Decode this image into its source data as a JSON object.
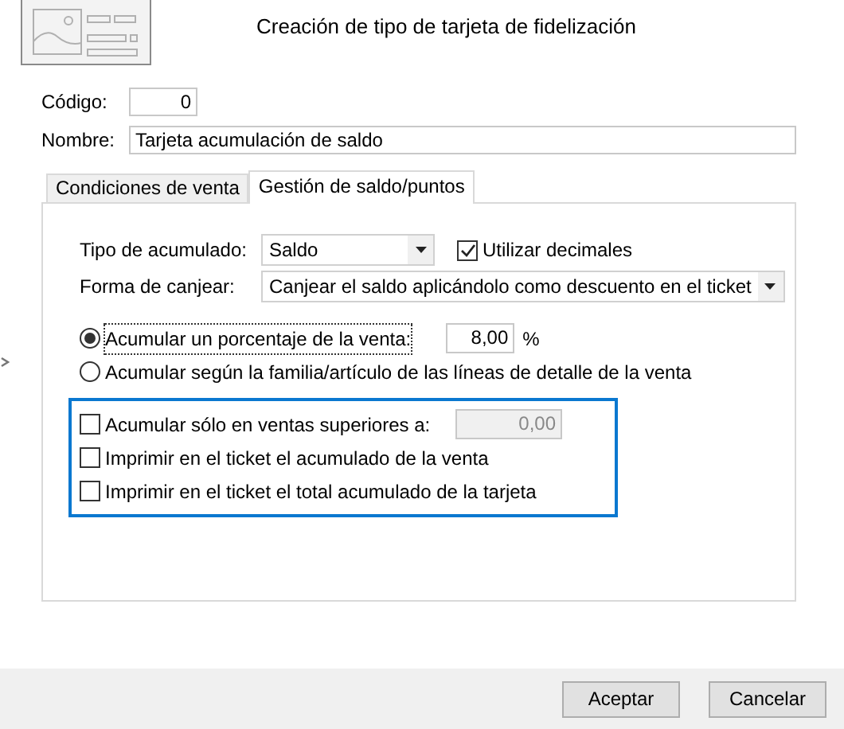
{
  "window": {
    "title": "Creación de tipo de tarjeta de fidelización"
  },
  "fields": [
    {
      "label": "Código:",
      "value": "0",
      "kind": "short"
    },
    {
      "label": "Nombre:",
      "value": "Tarjeta acumulación de saldo",
      "kind": "wide"
    }
  ],
  "tabs": [
    {
      "label": "Condiciones de venta",
      "selected": false
    },
    {
      "label": "Gestión de saldo/puntos",
      "selected": true
    }
  ],
  "selects": [
    {
      "label": "Tipo de acumulado:",
      "value": "Saldo",
      "kind": "short"
    },
    {
      "label": "Forma de canjear:",
      "value": "Canjear el saldo aplicándolo como descuento en el ticket",
      "kind": "wide"
    }
  ],
  "decimals_checkbox": {
    "label": "Utilizar decimales",
    "checked": true
  },
  "radios": [
    {
      "label": "Acumular un porcentaje de la venta:",
      "selected": true,
      "focused": true,
      "value": "8,00",
      "unit": "%"
    },
    {
      "label": "Acumular según la familia/artículo de las líneas de detalle de la venta",
      "selected": false,
      "focused": false
    }
  ],
  "options_group": {
    "focused": true,
    "items": [
      {
        "label": "Acumular sólo en ventas superiores a:",
        "checked": false,
        "value": "0,00",
        "disabled": true
      },
      {
        "label": "Imprimir en el ticket el acumulado de la venta",
        "checked": false
      },
      {
        "label": "Imprimir en el ticket el total acumulado de la tarjeta",
        "checked": false
      }
    ]
  },
  "buttons": [
    {
      "label": "Aceptar"
    },
    {
      "label": "Cancelar"
    }
  ]
}
